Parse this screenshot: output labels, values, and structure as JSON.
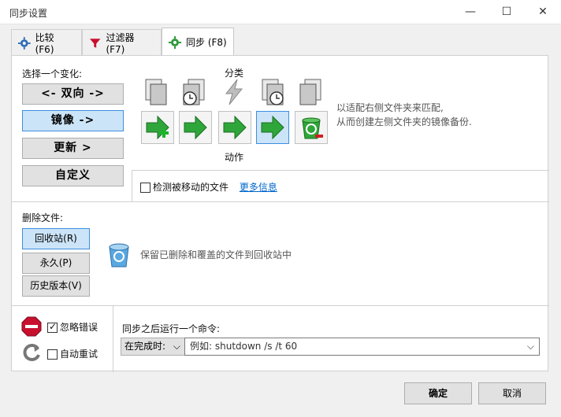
{
  "window": {
    "title": "同步设置",
    "minimize": "—",
    "maximize": "☐",
    "close": "✕"
  },
  "tabs": [
    {
      "label": "比较 (F6)"
    },
    {
      "label": "过滤器 (F7)"
    },
    {
      "label": "同步 (F8)"
    }
  ],
  "variant": {
    "heading": "选择一个变化:",
    "buttons": [
      "<- 双向 ->",
      "镜像 ->",
      "更新 >",
      "自定义"
    ],
    "selected_index": 1
  },
  "category": {
    "label": "分类"
  },
  "action": {
    "label": "动作"
  },
  "description": {
    "line1": "以适配右侧文件夹来匹配,",
    "line2": "从而创建左侧文件夹的镜像备份."
  },
  "detect_moved": {
    "label": "检测被移动的文件",
    "checked": false,
    "more_info": "更多信息"
  },
  "delete": {
    "heading": "删除文件:",
    "buttons": [
      "回收站(R)",
      "永久(P)",
      "历史版本(V)"
    ],
    "selected_index": 0,
    "description": "保留已删除和覆盖的文件到回收站中"
  },
  "errors": {
    "ignore_label": "忽略错误",
    "ignore_checked": true,
    "retry_label": "自动重试",
    "retry_checked": false
  },
  "command": {
    "heading": "同步之后运行一个命令:",
    "when": "在完成时:",
    "placeholder": "例如: shutdown /s /t 60"
  },
  "footer": {
    "ok": "确定",
    "cancel": "取消"
  },
  "colors": {
    "accent": "#3d8ee0",
    "selected_bg": "#cce4f7",
    "link": "#0066cc"
  }
}
